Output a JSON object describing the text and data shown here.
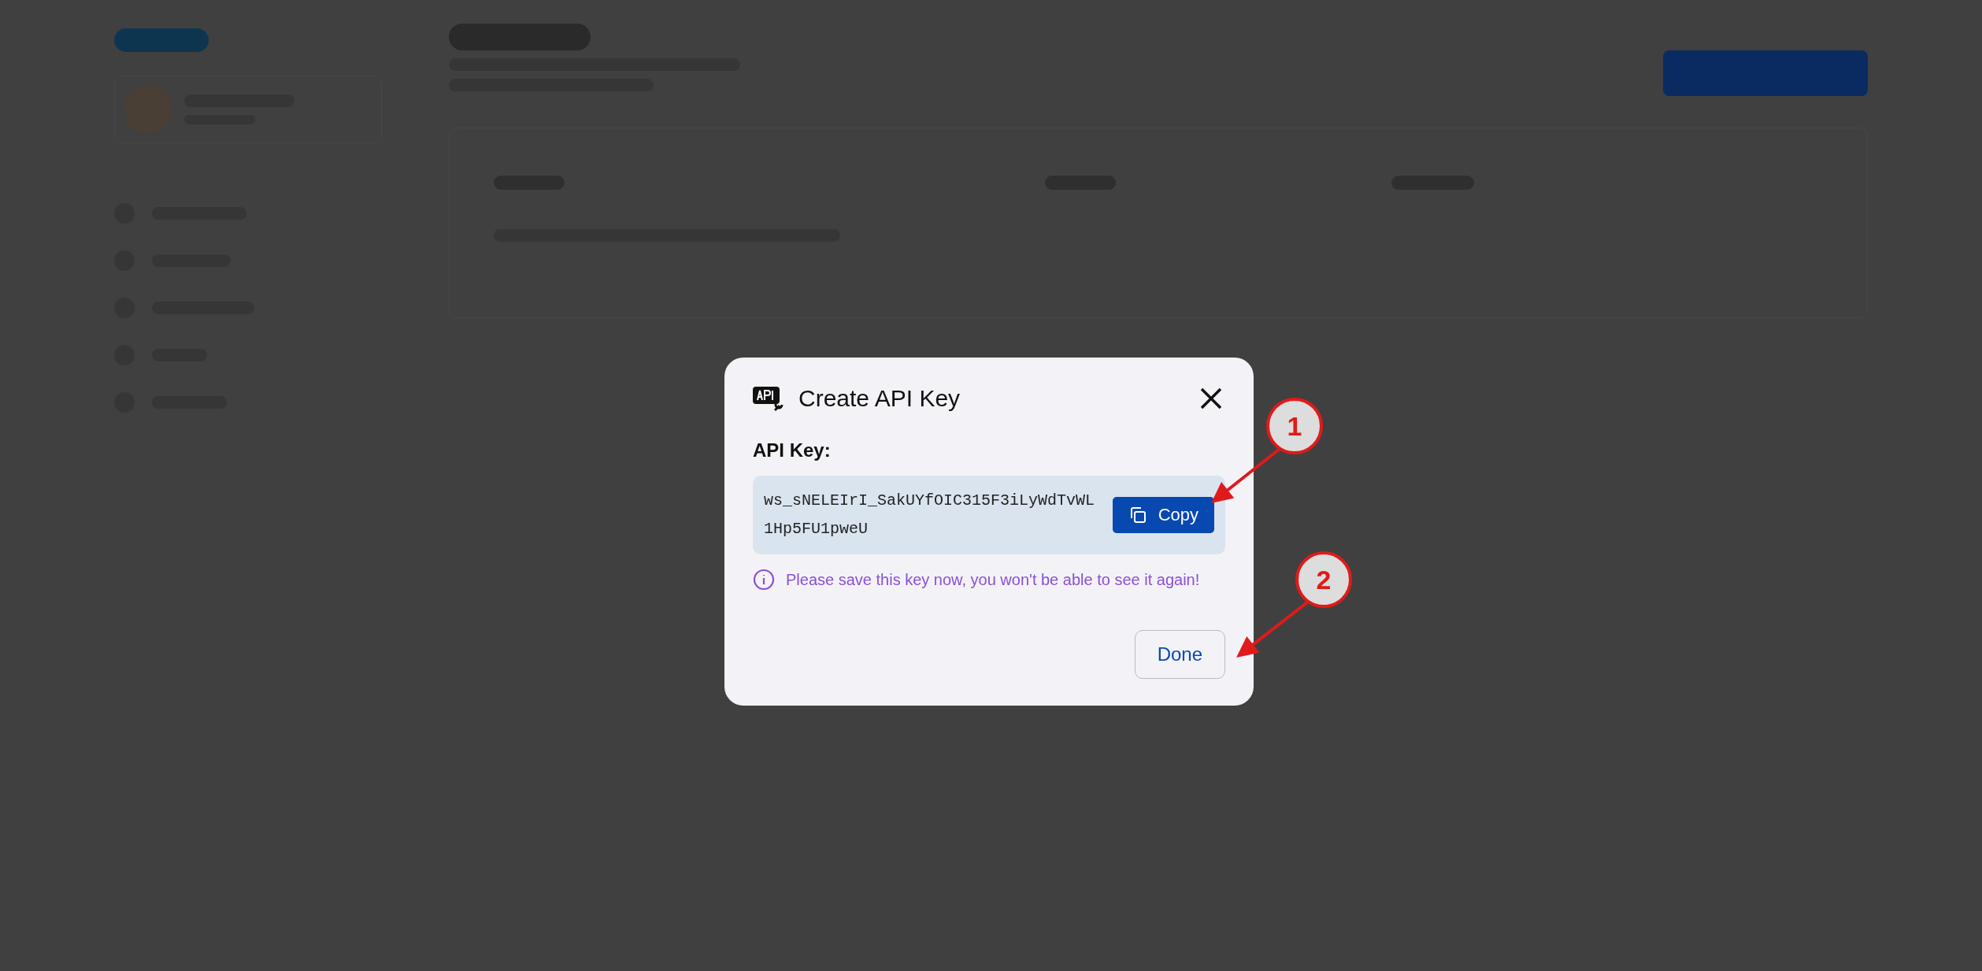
{
  "dialog": {
    "title": "Create API Key",
    "field_label": "API Key:",
    "key_value": "ws_sNELEIrI_SakUYfOIC315F3iLyWdTvWL1Hp5FU1pweU",
    "copy_button": "Copy",
    "warning": "Please save this key now, you won't be able to see it again!",
    "done_button": "Done"
  },
  "annotations": [
    {
      "label": "1"
    },
    {
      "label": "2"
    }
  ]
}
